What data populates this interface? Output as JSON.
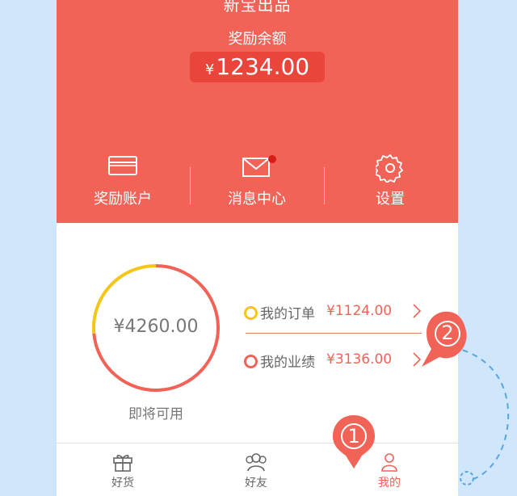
{
  "header": {
    "brand": "新宝出品",
    "balance_label": "奖励余额",
    "balance_currency": "¥",
    "balance_amount": "1234.00",
    "nav": [
      {
        "label": "奖励账户",
        "icon": "card-icon"
      },
      {
        "label": "消息中心",
        "icon": "mail-icon",
        "badge": true
      },
      {
        "label": "设置",
        "icon": "gear-icon"
      }
    ]
  },
  "summary": {
    "total": "¥4260.00",
    "total_label": "即将可用",
    "orders_share": 0.264,
    "performance_share": 0.736,
    "rows": [
      {
        "name": "我的订单",
        "value": "¥1124.00",
        "color": "#f5c518"
      },
      {
        "name": "我的业绩",
        "value": "¥3136.00",
        "color": "#f26357"
      }
    ]
  },
  "tabbar": {
    "tabs": [
      {
        "label": "好货",
        "icon": "gift-icon"
      },
      {
        "label": "好友",
        "icon": "friends-icon"
      },
      {
        "label": "我的",
        "icon": "person-icon",
        "active": true
      }
    ]
  },
  "annotations": {
    "pin_1": "1",
    "pin_2": "2"
  },
  "colors": {
    "accent": "#f26357",
    "ring_yellow": "#f5c518",
    "background": "#cfe6fb"
  }
}
